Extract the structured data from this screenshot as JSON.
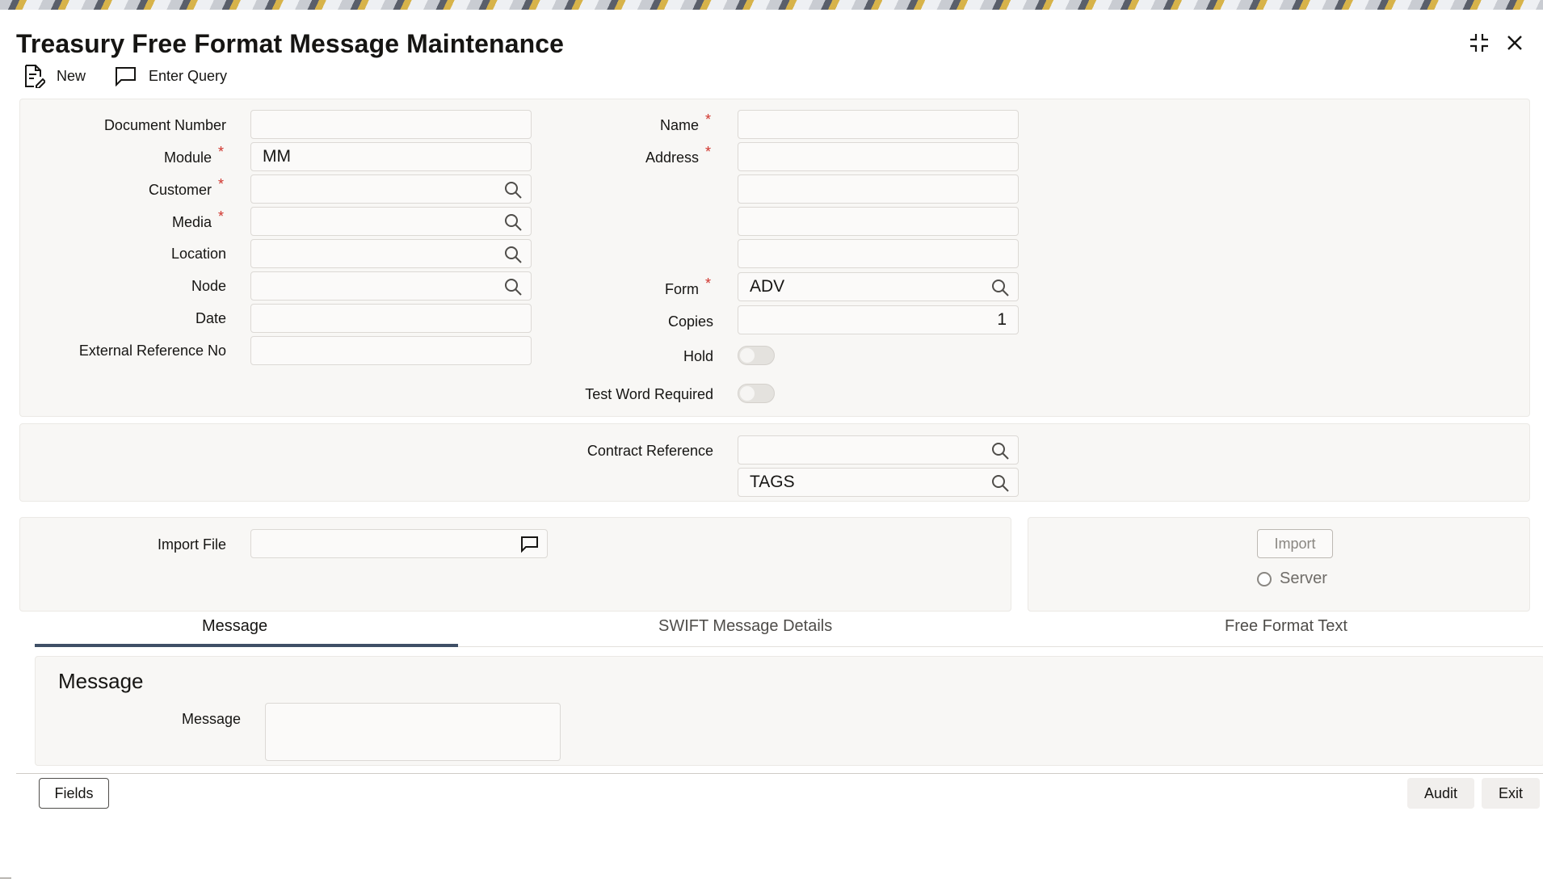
{
  "window": {
    "title": "Treasury Free Format Message Maintenance",
    "icons": [
      "collapse-icon",
      "close-icon"
    ]
  },
  "toolbar": {
    "new_label": "New",
    "enter_query_label": "Enter Query"
  },
  "form": {
    "document_number": {
      "label": "Document Number",
      "value": ""
    },
    "module": {
      "label": "Module",
      "value": "MM"
    },
    "customer": {
      "label": "Customer",
      "value": ""
    },
    "media": {
      "label": "Media",
      "value": ""
    },
    "location": {
      "label": "Location",
      "value": ""
    },
    "node": {
      "label": "Node",
      "value": ""
    },
    "date": {
      "label": "Date",
      "value": ""
    },
    "external_reference": {
      "label": "External Reference No",
      "value": ""
    },
    "name": {
      "label": "Name",
      "value": ""
    },
    "address": {
      "label": "Address",
      "lines": [
        "",
        "",
        "",
        ""
      ]
    },
    "form": {
      "label": "Form",
      "value": "ADV"
    },
    "copies": {
      "label": "Copies",
      "value": "1"
    },
    "hold": {
      "label": "Hold",
      "on": false
    },
    "test_word": {
      "label": "Test Word Required",
      "on": false
    },
    "required_marker": "*"
  },
  "contract": {
    "label": "Contract Reference",
    "value": "",
    "tags_value": "TAGS"
  },
  "import": {
    "file_label": "Import File",
    "file_value": "",
    "button_label": "Import",
    "server_label": "Server"
  },
  "tabs": [
    {
      "label": "Message",
      "active": true
    },
    {
      "label": "SWIFT Message Details",
      "active": false
    },
    {
      "label": "Free Format Text",
      "active": false
    }
  ],
  "message": {
    "heading": "Message",
    "field_label": "Message",
    "value": ""
  },
  "footer": {
    "fields_label": "Fields",
    "audit_label": "Audit",
    "exit_label": "Exit"
  },
  "colors": {
    "required": "#d0342c",
    "tab_underline": "#3f4f66",
    "panel_bg": "#f8f7f5"
  }
}
